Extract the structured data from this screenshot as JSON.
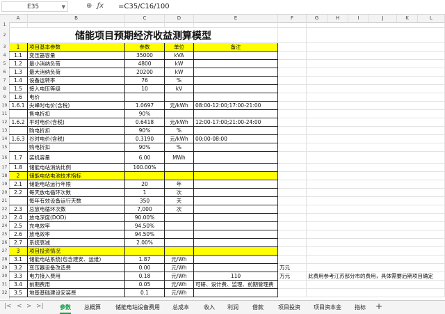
{
  "formula_bar": {
    "cell_ref": "E35",
    "formula": "=C35/C16/100"
  },
  "columns": [
    "A",
    "B",
    "C",
    "D",
    "E",
    "F",
    "G",
    "H",
    "I",
    "J",
    "K",
    "L"
  ],
  "rows": [
    {
      "n": "1",
      "a": "",
      "b": "",
      "c": "",
      "d": "",
      "e": ""
    },
    {
      "n": "2",
      "a": "",
      "b": "储能项目预期经济收益测算模型",
      "c": "",
      "d": "",
      "e": "",
      "title": true
    },
    {
      "n": "3",
      "a": "1",
      "b": "项目基本参数",
      "c": "参数",
      "d": "单位",
      "e": "备注",
      "yellow": true
    },
    {
      "n": "4",
      "a": "1.1",
      "b": "变压器容量",
      "c": "35000",
      "d": "kVA",
      "e": ""
    },
    {
      "n": "5",
      "a": "1.2",
      "b": "最小消纳负荷",
      "c": "4800",
      "d": "kW",
      "e": ""
    },
    {
      "n": "6",
      "a": "1.3",
      "b": "最大消纳负荷",
      "c": "20200",
      "d": "kW",
      "e": ""
    },
    {
      "n": "7",
      "a": "1.4",
      "b": "设备运转率",
      "c": "76",
      "d": "%",
      "e": ""
    },
    {
      "n": "8",
      "a": "1.5",
      "b": "接入电压等级",
      "c": "10",
      "d": "kV",
      "e": ""
    },
    {
      "n": "9",
      "a": "1.6",
      "b": "电价",
      "c": "",
      "d": "",
      "e": ""
    },
    {
      "n": "10",
      "a": "1.6.1",
      "b": "尖峰时电价(含税)",
      "c": "1.0697",
      "d": "元/kWh",
      "e": "08:00-12:00;17:00-21:00"
    },
    {
      "n": "11",
      "a": "",
      "b": "售电折扣",
      "c": "90%",
      "d": "",
      "e": ""
    },
    {
      "n": "12",
      "a": "1.6.2",
      "b": "平时电价(含税)",
      "c": "0.6418",
      "d": "元/kWh",
      "e": "12:00-17:00;21:00-24:00"
    },
    {
      "n": "13",
      "a": "",
      "b": "购电折扣",
      "c": "90%",
      "d": "%",
      "e": ""
    },
    {
      "n": "14",
      "a": "1.6.3",
      "b": "谷时电价(含税)",
      "c": "0.3190",
      "d": "元/kWh",
      "e": "00:00-08:00"
    },
    {
      "n": "15",
      "a": "",
      "b": "购电折扣",
      "c": "90%",
      "d": "%",
      "e": ""
    },
    {
      "n": "16",
      "a": "1.7",
      "b": "装机容量",
      "c": "6.00",
      "d": "MWh",
      "e": "",
      "tall": true
    },
    {
      "n": "17",
      "a": "1.8",
      "b": "储能电站消纳比例",
      "c": "100.00%",
      "d": "",
      "e": ""
    },
    {
      "n": "18",
      "a": "2",
      "b": "储能电站电池技术指标",
      "c": "",
      "d": "",
      "e": "",
      "yellow": true
    },
    {
      "n": "19",
      "a": "2.1",
      "b": "储能电站运行年限",
      "c": "20",
      "d": "年",
      "e": ""
    },
    {
      "n": "20",
      "a": "2.2",
      "b": "每天放电循环次数",
      "c": "1",
      "d": "次",
      "e": ""
    },
    {
      "n": "21",
      "a": "",
      "b": "每年有效设备运行天数",
      "c": "350",
      "d": "天",
      "e": ""
    },
    {
      "n": "22",
      "a": "2.3",
      "b": "总放电循环次数",
      "c": "7,000",
      "d": "次",
      "e": ""
    },
    {
      "n": "23",
      "a": "2.4",
      "b": "放电深度(DOD)",
      "c": "90.00%",
      "d": "",
      "e": ""
    },
    {
      "n": "24",
      "a": "2.5",
      "b": "充电效率",
      "c": "94.50%",
      "d": "",
      "e": ""
    },
    {
      "n": "25",
      "a": "2.6",
      "b": "放电效率",
      "c": "94.50%",
      "d": "",
      "e": ""
    },
    {
      "n": "26",
      "a": "2.7",
      "b": "系统衰减",
      "c": "2.00%",
      "d": "",
      "e": ""
    },
    {
      "n": "27",
      "a": "3",
      "b": "项目投资情况",
      "c": "",
      "d": "",
      "e": "",
      "yellow": true
    },
    {
      "n": "28",
      "a": "3.1",
      "b": "储能电站系统(包含建安、运维)",
      "c": "1.87",
      "d": "元/Wh",
      "e": ""
    },
    {
      "n": "29",
      "a": "3.2",
      "b": "变压器设备改造费",
      "c": "0.00",
      "d": "元/Wh",
      "e": "",
      "f": "万元"
    },
    {
      "n": "30",
      "a": "3.3",
      "b": "电力接入费用",
      "c": "0.18",
      "d": "元/Wh",
      "e": "110",
      "f": "万元",
      "g": "此费用参考江苏部分市的费用，具体需要后期项目确定"
    },
    {
      "n": "31",
      "a": "3.4",
      "b": "前期费用",
      "c": "0.05",
      "d": "元/Wh",
      "e": "可研、设计费、监理、前期管理费"
    },
    {
      "n": "32",
      "a": "3.5",
      "b": "地基基础建设安装费",
      "c": "0.1",
      "d": "元/Wh",
      "e": ""
    }
  ],
  "tabs": [
    "参数",
    "总概算",
    "储能电站设备费用",
    "总成本",
    "收入",
    "利润",
    "借款",
    "项目投资",
    "项目资本金",
    "指标"
  ],
  "active_tab": "参数",
  "colors": {
    "header_fill": "#ffff00",
    "active_tab": "#1a9e4b"
  }
}
